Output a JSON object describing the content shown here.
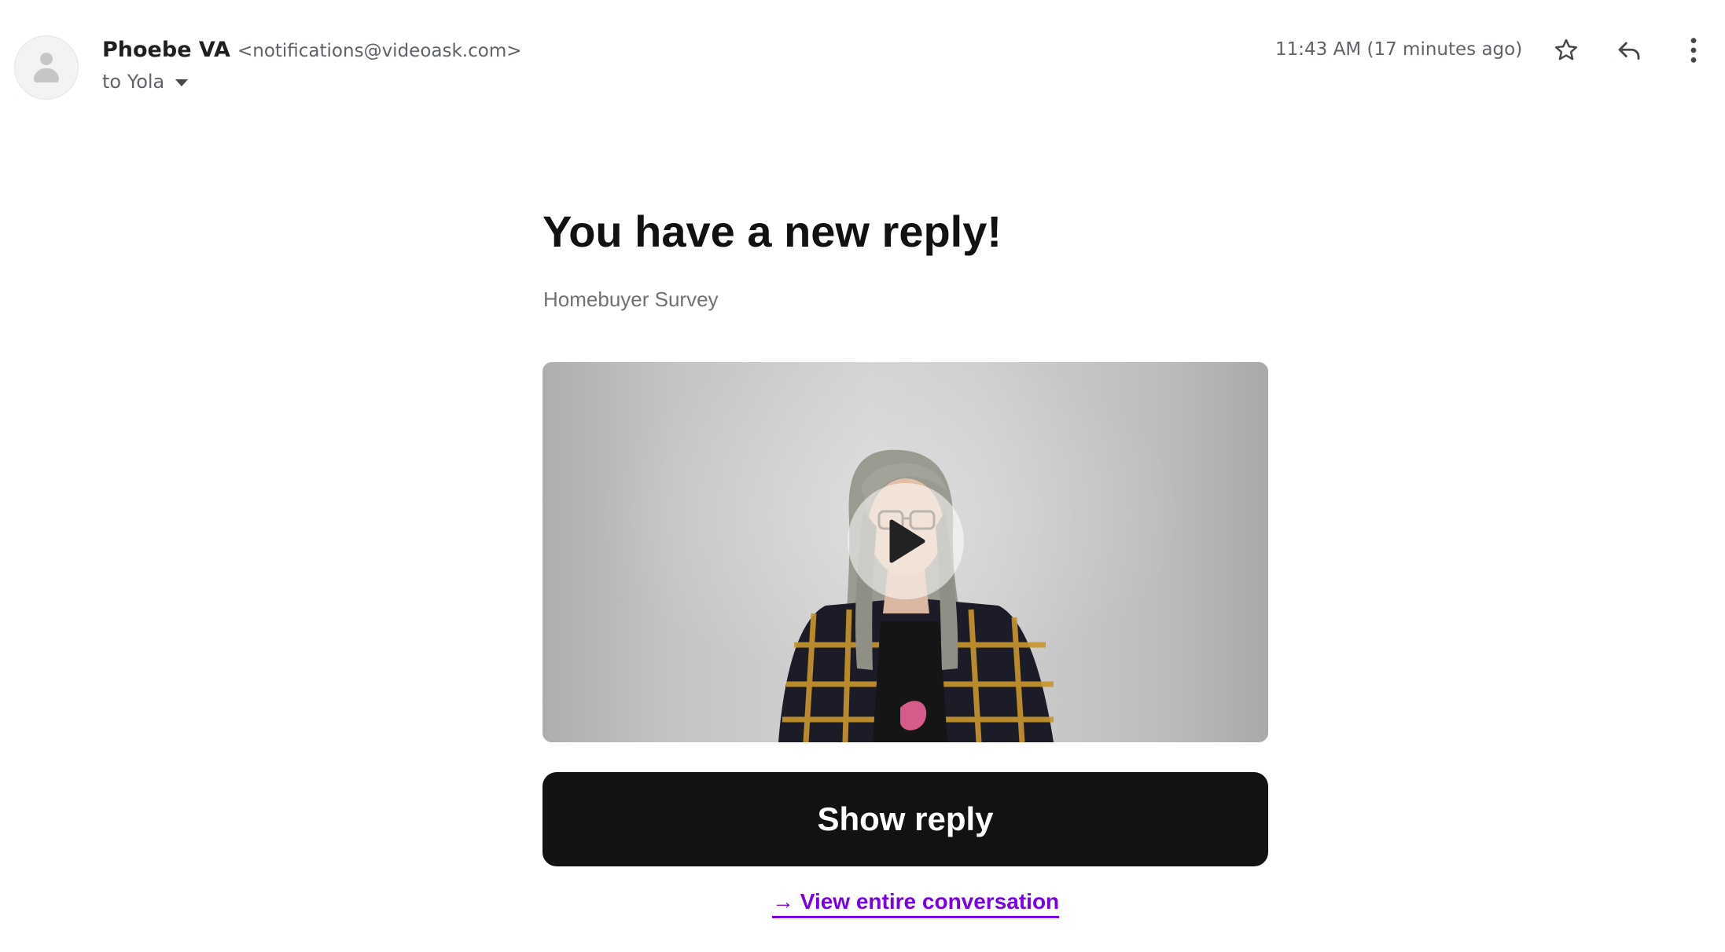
{
  "email": {
    "sender_name": "Phoebe VA",
    "sender_email": "<notifications@videoask.com>",
    "recipient": "to Yola",
    "timestamp": "11:43 AM (17 minutes ago)",
    "icons": {
      "avatar": "default-person-avatar",
      "details": "caret-down-icon",
      "star": "star-outline-icon",
      "reply": "reply-arrow-icon",
      "more": "vertical-dots-icon"
    }
  },
  "message": {
    "headline": "You have a new reply!",
    "survey_name": "Homebuyer Survey",
    "video_icon": "play-icon",
    "show_reply_label": "Show reply",
    "view_conversation_label": "→ View entire conversation"
  },
  "colors": {
    "button_bg": "#121212",
    "link": "#7b00e6",
    "muted_text": "#717171"
  }
}
